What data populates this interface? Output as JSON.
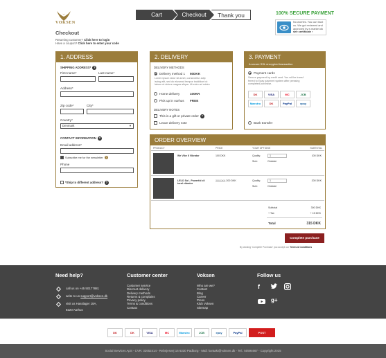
{
  "brand": {
    "name": "VOKSEN"
  },
  "checkout": {
    "title": "Checkout",
    "returning_text": "Returning customer?",
    "returning_link": "Click here to login",
    "coupon_text": "Have a coupon?",
    "coupon_link": "Click here to enter your code"
  },
  "steps": [
    "Cart",
    "Checkout",
    "Thank you"
  ],
  "secure": {
    "title": "100% SECURE PAYMENT",
    "text1": "No worries. You can trust",
    "text2": "us. We got reviewed and",
    "text3": "approved by e-market.dk",
    "link": "see certificate ›"
  },
  "address": {
    "header": "1. ADDRESS",
    "shipping_label": "SHIPPING ADDRESS*",
    "first_name": "First name*",
    "last_name": "Last name*",
    "address": "Address*",
    "zip": "Zip code*",
    "city": "City*",
    "country": "Country*",
    "country_value": "Denmark",
    "contact": "CONTACT INFORMATION",
    "email": "Email address*",
    "newsletter": "Subscribe me for the newsletter",
    "phone": "Phone",
    "ship_diff": "*Ship to different address?"
  },
  "delivery": {
    "header": "2. DELIVERY",
    "methods_label": "DELIVERY METHODS",
    "m1_label": "Delivery method 1",
    "m1_price": "50DKK",
    "m1_desc1": "Lorem ipsum dolor sit amet, consectetur adip",
    "m1_desc2": "iscing elit, sed do eiusmod tempor incididunt ut",
    "m1_desc3": "labore et dolore magna aliqua. Ut enim ad minim",
    "m2_label": "Home delivery",
    "m2_price": "100KR",
    "m3_label": "Pick up in Aarhus",
    "m3_price": "FREE",
    "notes_label": "DELIVERY NOTES",
    "gift": "This is a gift or private order",
    "leave": "Leave delivery note"
  },
  "payment": {
    "header": "3. PAYMENT",
    "sub": "A secure SSL encrypted transaction",
    "cards_label": "Payment cards",
    "cards_desc1": "Secure payment by credit card. You will be transf",
    "cards_desc2": "ferred to Epay payment system after pressing",
    "cards_desc3": "completed purchase.",
    "bank": "Bank transfer",
    "logos": [
      "DK",
      "VISA",
      "MC",
      "JCB",
      "Maestro",
      "DK",
      "PayPal",
      "epay"
    ]
  },
  "order": {
    "header": "ORDER OVERVIEW",
    "cols": [
      "PRODUCT",
      "PRICE",
      "YOUR OPTIONS",
      "SUBTOTAL"
    ],
    "items": [
      {
        "name": "We Vibe II Vibrator",
        "price": "100 DKK",
        "qty_label": "Quality:",
        "qty": "1",
        "size_label": "Size:",
        "size": "Onesize",
        "subtotal": "100 DKK"
      },
      {
        "name1": "LELO Soi - Powerful cli",
        "name2": "toral vibrator",
        "old_price": "300 DKK",
        "price": "200 DKK",
        "qty_label": "Quality:",
        "qty": "1",
        "size_label": "Size:",
        "size": "Onesize",
        "subtotal": "200 DKK"
      }
    ],
    "subtotal_label": "Subtotal",
    "subtotal": "300 DKK",
    "tax_label": "+ Tax",
    "tax": "+ 15 DKK",
    "total_label": "Total",
    "total": "315 DKK"
  },
  "purchase": {
    "button": "Complete purchase",
    "terms": "By clicking 'Complete Purchase' you accept our",
    "terms_link": "Terms & Conditions"
  },
  "footer": {
    "help_title": "Need help?",
    "help_phone": "call us on +45 50177881",
    "help_write": "write to us",
    "help_email": "support@voksen.dk",
    "help_visit1": "visit us Hasslager 18A,",
    "help_visit2": "8220 Aarhus",
    "cc_title": "Customer center",
    "cc_links": [
      "Customer service",
      "Discreet delivery",
      "Delivery methods",
      "Returns & complains",
      "Privacy policy",
      "Terms & conditions",
      "Contact"
    ],
    "vk_title": "Voksen",
    "vk_links": [
      "Who are we?",
      "Contact",
      "Blog",
      "Career",
      "Press",
      "Klub Voksen",
      "Sitemap"
    ],
    "follow_title": "Follow us"
  },
  "strip_logos": [
    "DK",
    "DK",
    "VISA",
    "MC",
    "Maestro",
    "JCB",
    "epay",
    "PayPal",
    "POST"
  ],
  "copyright": "Social Services ApS - CVR: 32652414 - Rebnjesvej 16 6330 Padborg - Mail: kontakt@voksen.dk - Tel.: 50594667 - Copyright 2015"
}
